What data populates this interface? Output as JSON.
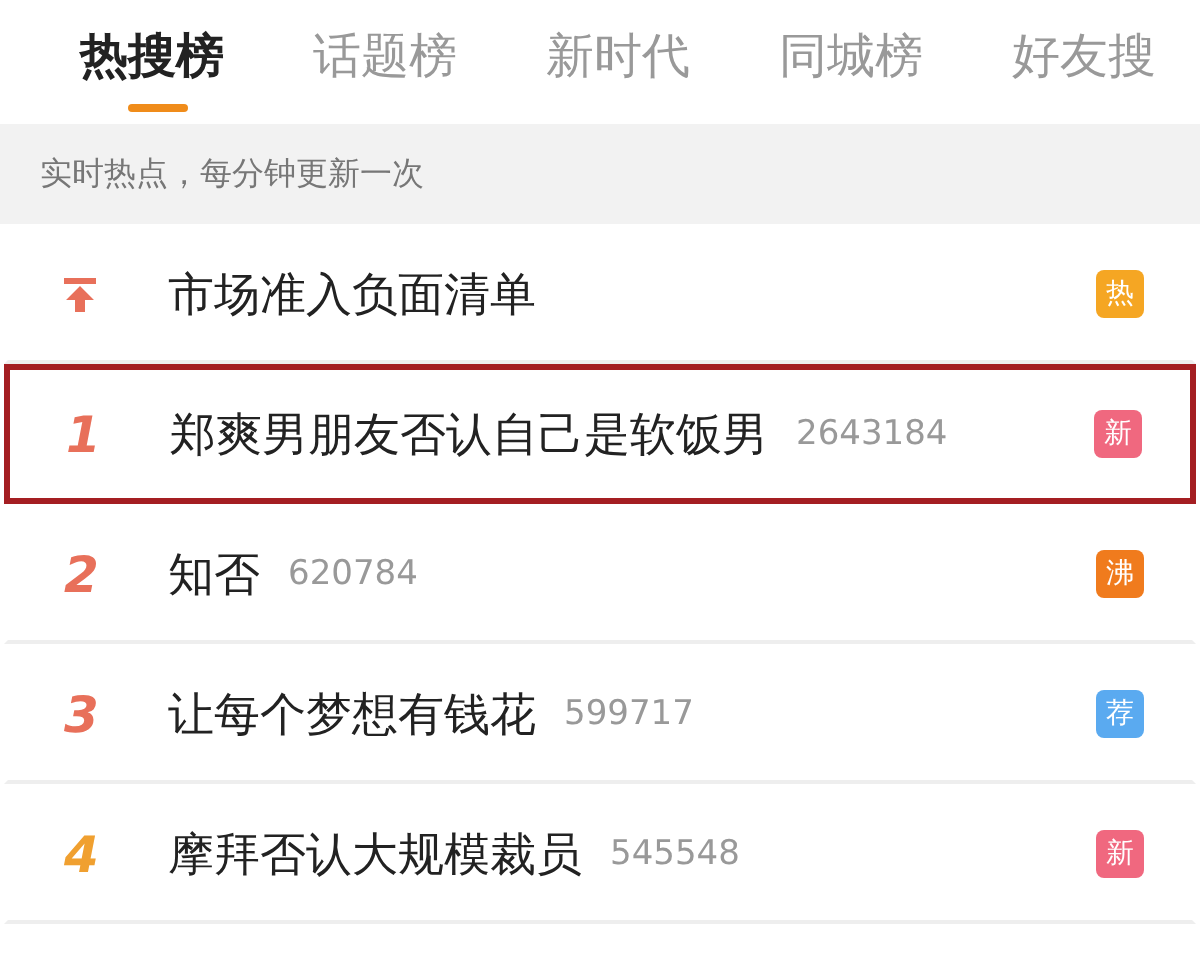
{
  "tabs": [
    {
      "label": "热搜榜",
      "selected": true
    },
    {
      "label": "话题榜",
      "selected": false
    },
    {
      "label": "新时代",
      "selected": false
    },
    {
      "label": "同城榜",
      "selected": false
    },
    {
      "label": "好友搜",
      "selected": false
    }
  ],
  "notice": "实时热点，每分钟更新一次",
  "items": [
    {
      "kind": "pinned",
      "title": "市场准入负面清单",
      "badge": {
        "text": "热",
        "color": "#f5a623"
      },
      "highlighted": false
    },
    {
      "kind": "ranked",
      "rank": {
        "text": "1",
        "color": "#e8705a"
      },
      "title": "郑爽男朋友否认自己是软饭男",
      "count": "2643184",
      "badge": {
        "text": "新",
        "color": "#f0687f"
      },
      "highlighted": true
    },
    {
      "kind": "ranked",
      "rank": {
        "text": "2",
        "color": "#e8705a"
      },
      "title": "知否",
      "count": "620784",
      "badge": {
        "text": "沸",
        "color": "#f07b1d"
      },
      "highlighted": false
    },
    {
      "kind": "ranked",
      "rank": {
        "text": "3",
        "color": "#e8705a"
      },
      "title": "让每个梦想有钱花",
      "count": "599717",
      "badge": {
        "text": "荐",
        "color": "#5aaaf0"
      },
      "highlighted": false
    },
    {
      "kind": "ranked",
      "rank": {
        "text": "4",
        "color": "#f0a030"
      },
      "title": "摩拜否认大规模裁员",
      "count": "545548",
      "badge": {
        "text": "新",
        "color": "#f0687f"
      },
      "highlighted": false
    }
  ]
}
